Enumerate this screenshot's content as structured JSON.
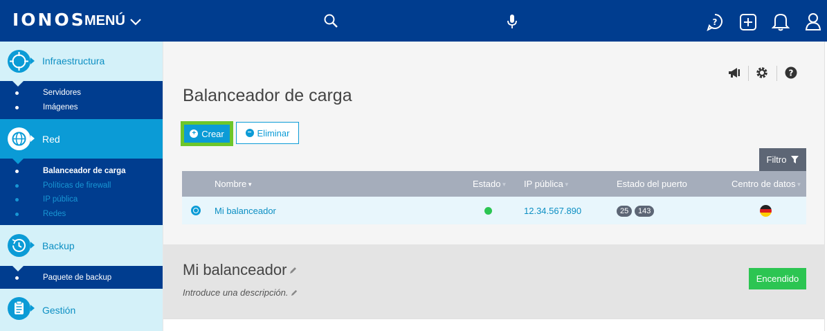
{
  "topbar": {
    "logo": "IONOS",
    "menu_label": "MENÚ",
    "icons": [
      "search-icon",
      "microphone-icon",
      "help-chat-icon",
      "add-icon",
      "bell-icon",
      "user-icon"
    ]
  },
  "sidebar": {
    "sections": [
      {
        "label": "Infraestructura",
        "icon": "infrastructure-icon",
        "active": false
      },
      {
        "label": "Red",
        "icon": "network-icon",
        "active": true
      },
      {
        "label": "Backup",
        "icon": "backup-icon",
        "active": false
      },
      {
        "label": "Gestión",
        "icon": "clipboard-icon",
        "active": false
      }
    ],
    "infraestructura_items": [
      "Servidores",
      "Imágenes"
    ],
    "red_items": [
      "Balanceador de carga",
      "Políticas de firewall",
      "IP pública",
      "Redes"
    ],
    "backup_items": [
      "Paquete de backup"
    ]
  },
  "main": {
    "title": "Balanceador de carga",
    "util_icons": [
      "megaphone-icon",
      "gear-icon",
      "help-icon"
    ],
    "buttons": {
      "crear": "Crear",
      "eliminar": "Eliminar",
      "filtro": "Filtro"
    },
    "table": {
      "columns": [
        "Nombre",
        "Estado",
        "IP pública",
        "Estado del puerto",
        "Centro de datos"
      ],
      "rows": [
        {
          "nombre": "Mi balanceador",
          "estado": "green",
          "ip": "12.34.567.890",
          "puertos": [
            "25",
            "143"
          ],
          "centro": "de-flag"
        }
      ]
    }
  },
  "detail": {
    "title": "Mi balanceador",
    "description_placeholder": "Introduce una descripción.",
    "status": "Encendido"
  },
  "colors": {
    "navy": "#003d8f",
    "accent_blue": "#0b9bd6",
    "light_cyan": "#d4f1f9",
    "green": "#2cc552",
    "highlight_green": "#6dc62a"
  }
}
